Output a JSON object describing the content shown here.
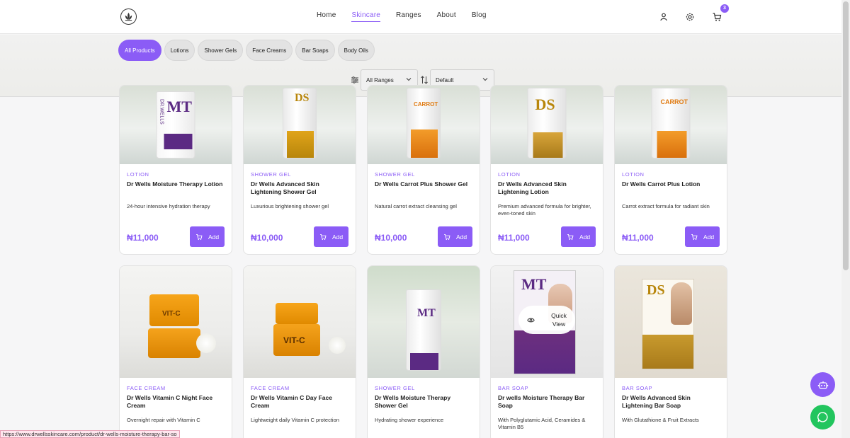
{
  "nav": {
    "items": [
      "Home",
      "Skincare",
      "Ranges",
      "About",
      "Blog"
    ],
    "active_index": 1,
    "cart_count": "3"
  },
  "filters": {
    "chips": [
      "All Products",
      "Lotions",
      "Shower Gels",
      "Face Creams",
      "Bar Soaps",
      "Body Oils"
    ],
    "active_index": 0,
    "range_select": "All Ranges",
    "sort_select": "Default"
  },
  "colors": {
    "accent": "#8b5cf6",
    "whatsapp": "#22c55e"
  },
  "products_row1": [
    {
      "category": "LOTION",
      "title": "Dr Wells Moisture Therapy Lotion",
      "desc": "24-hour intensive hydration therapy",
      "price": "₦11,000",
      "add": "Add"
    },
    {
      "category": "SHOWER GEL",
      "title": "Dr Wells Advanced Skin Lightening Shower Gel",
      "desc": "Luxurious brightening shower gel",
      "price": "₦10,000",
      "add": "Add"
    },
    {
      "category": "SHOWER GEL",
      "title": "Dr Wells Carrot Plus Shower Gel",
      "desc": "Natural carrot extract cleansing gel",
      "price": "₦10,000",
      "add": "Add"
    },
    {
      "category": "LOTION",
      "title": "Dr Wells Advanced Skin Lightening Lotion",
      "desc": "Premium advanced formula for brighter, even-toned skin",
      "price": "₦11,000",
      "add": "Add"
    },
    {
      "category": "LOTION",
      "title": "Dr Wells Carrot Plus Lotion",
      "desc": "Carrot extract formula for radiant skin",
      "price": "₦11,000",
      "add": "Add"
    }
  ],
  "products_row2": [
    {
      "category": "FACE CREAM",
      "title": "Dr Wells Vitamin C Night Face Cream",
      "desc": "Overnight repair with Vitamin C"
    },
    {
      "category": "FACE CREAM",
      "title": "Dr Wells Vitamin C Day Face Cream",
      "desc": "Lightweight daily Vitamin C protection"
    },
    {
      "category": "SHOWER GEL",
      "title": "Dr Wells Moisture Therapy Shower Gel",
      "desc": "Hydrating shower experience"
    },
    {
      "category": "BAR SOAP",
      "title": "Dr wells Moisture Therapy Bar Soap",
      "desc": "With Polyglutamic Acid, Ceramides & Vitamin B5"
    },
    {
      "category": "BAR SOAP",
      "title": "Dr Wells Advanced Skin Lightening Bar Soap",
      "desc": "With Glutathione & Fruit Extracts"
    }
  ],
  "quick_view": "Quick View",
  "packaging": {
    "brand": "DR.WELLS",
    "mt": "MT",
    "ds": "DS",
    "carrot": "CARROT",
    "vitc": "VIT-C"
  },
  "status_url": "https://www.drwellsskincare.com/product/dr-wells-moisture-therapy-bar-so"
}
